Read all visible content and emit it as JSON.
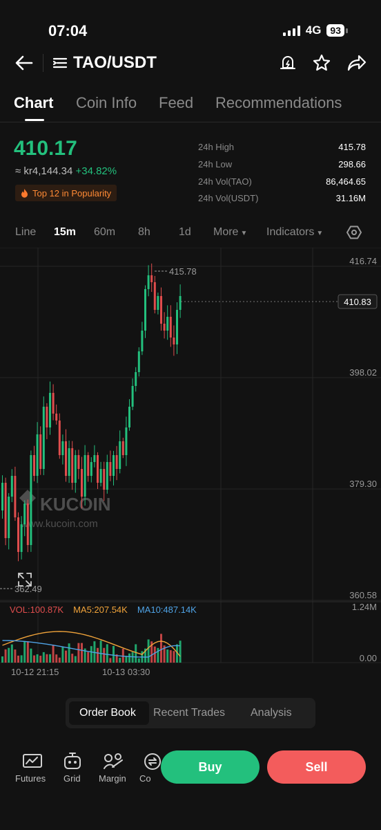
{
  "status_bar": {
    "time": "07:04",
    "network": "4G",
    "battery": "93"
  },
  "header": {
    "pair": "TAO/USDT"
  },
  "tabs": [
    {
      "label": "Chart",
      "active": true
    },
    {
      "label": "Coin Info",
      "active": false
    },
    {
      "label": "Feed",
      "active": false
    },
    {
      "label": "Recommendations",
      "active": false
    }
  ],
  "price": {
    "last": "410.17",
    "fiat": "≈ kr4,144.34",
    "change": "+34.82%",
    "popularity": "Top 12 in Popularity"
  },
  "stats": [
    {
      "label": "24h High",
      "value": "415.78"
    },
    {
      "label": "24h Low",
      "value": "298.66"
    },
    {
      "label": "24h Vol(TAO)",
      "value": "86,464.65"
    },
    {
      "label": "24h Vol(USDT)",
      "value": "31.16M"
    }
  ],
  "intervals": {
    "line": "Line",
    "m15": "15m",
    "m60": "60m",
    "h8": "8h",
    "d1": "1d",
    "more": "More",
    "indicators": "Indicators"
  },
  "chart": {
    "price_axis": [
      "416.74",
      "398.02",
      "379.30",
      "360.58"
    ],
    "current_price_tag": "410.83",
    "high_marker": "415.78",
    "low_marker": "362.49",
    "watermark_brand": "KUCOIN",
    "watermark_url": "www.kucoin.com",
    "volume_axis": [
      "1.24M",
      "0.00"
    ],
    "time_axis": [
      "10-12 21:15",
      "10-13 03:30"
    ]
  },
  "volume_legend": {
    "vol": "VOL:100.87K",
    "ma5": "MA5:207.54K",
    "ma10": "MA10:487.14K"
  },
  "colors": {
    "up": "#23c07d",
    "down": "#e04d4d",
    "ma5": "#f0a33a",
    "ma10": "#4fa3e6"
  },
  "segmented": {
    "order_book": "Order Book",
    "recent_trades": "Recent Trades",
    "analysis": "Analysis"
  },
  "bottom_nav": {
    "futures": "Futures",
    "grid": "Grid",
    "margin": "Margin",
    "partial": "Co",
    "buy": "Buy",
    "sell": "Sell"
  }
}
